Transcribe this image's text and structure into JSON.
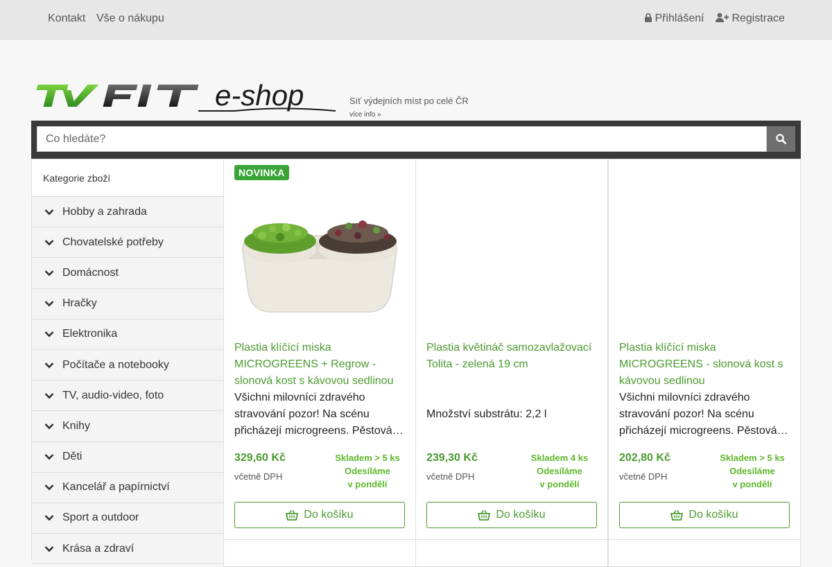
{
  "topbar": {
    "links": [
      "Kontakt",
      "Vše o nákupu"
    ],
    "login": "Přihlášení",
    "register": "Registrace"
  },
  "header": {
    "tagline": "Síť výdejních míst po celé ČR",
    "more_info": "více info »"
  },
  "search": {
    "placeholder": "Co hledáte?"
  },
  "sidebar": {
    "title": "Kategorie zboží",
    "categories": [
      "Hobby a zahrada",
      "Chovatelské potřeby",
      "Domácnost",
      "Hračky",
      "Elektronika",
      "Počítače a notebooky",
      "TV, audio-video, foto",
      "Knihy",
      "Děti",
      "Kancelář a papírnictví",
      "Sport a outdoor",
      "Krása a zdraví"
    ]
  },
  "products": [
    {
      "badge": "NOVINKA",
      "title": "Plastia klíčící miska MICROGREENS + Regrow - slonová kost s kávovou sedlinou",
      "desc": [
        "Všichni milovníci zdravého",
        "stravování pozor! Na scénu",
        "přicházejí microgreens. Pěstová…"
      ],
      "price": "329,60 Kč",
      "vat": "včetně DPH",
      "stock": [
        "Skladem > 5 ks",
        "Odesíláme",
        "v pondělí"
      ],
      "cart": "Do košíku"
    },
    {
      "title": "Plastia květináč samozavlažovací Tolita - zelená 19 cm",
      "desc": [
        "",
        "Množství substrátu: 2,2 l",
        ""
      ],
      "price": "239,30 Kč",
      "vat": "včetně DPH",
      "stock": [
        "Skladem 4 ks",
        "Odesíláme",
        "v pondělí"
      ],
      "cart": "Do košíku"
    },
    {
      "title": "Plastia klíčící miska MICROGREENS - slonová kost s kávovou sedlinou",
      "desc": [
        "Všichni milovníci zdravého",
        "stravování pozor! Na scénu",
        "přicházejí microgreens. Pěstová…"
      ],
      "price": "202,80 Kč",
      "vat": "včetně DPH",
      "stock": [
        "Skladem > 5 ks",
        "Odesíláme",
        "v pondělí"
      ],
      "cart": "Do košíku"
    }
  ],
  "colors": {
    "accent_green": "#4a9b2f",
    "stock_green": "#5cb82a",
    "badge_green": "#3aa536",
    "search_bar": "#3a3a3a"
  }
}
